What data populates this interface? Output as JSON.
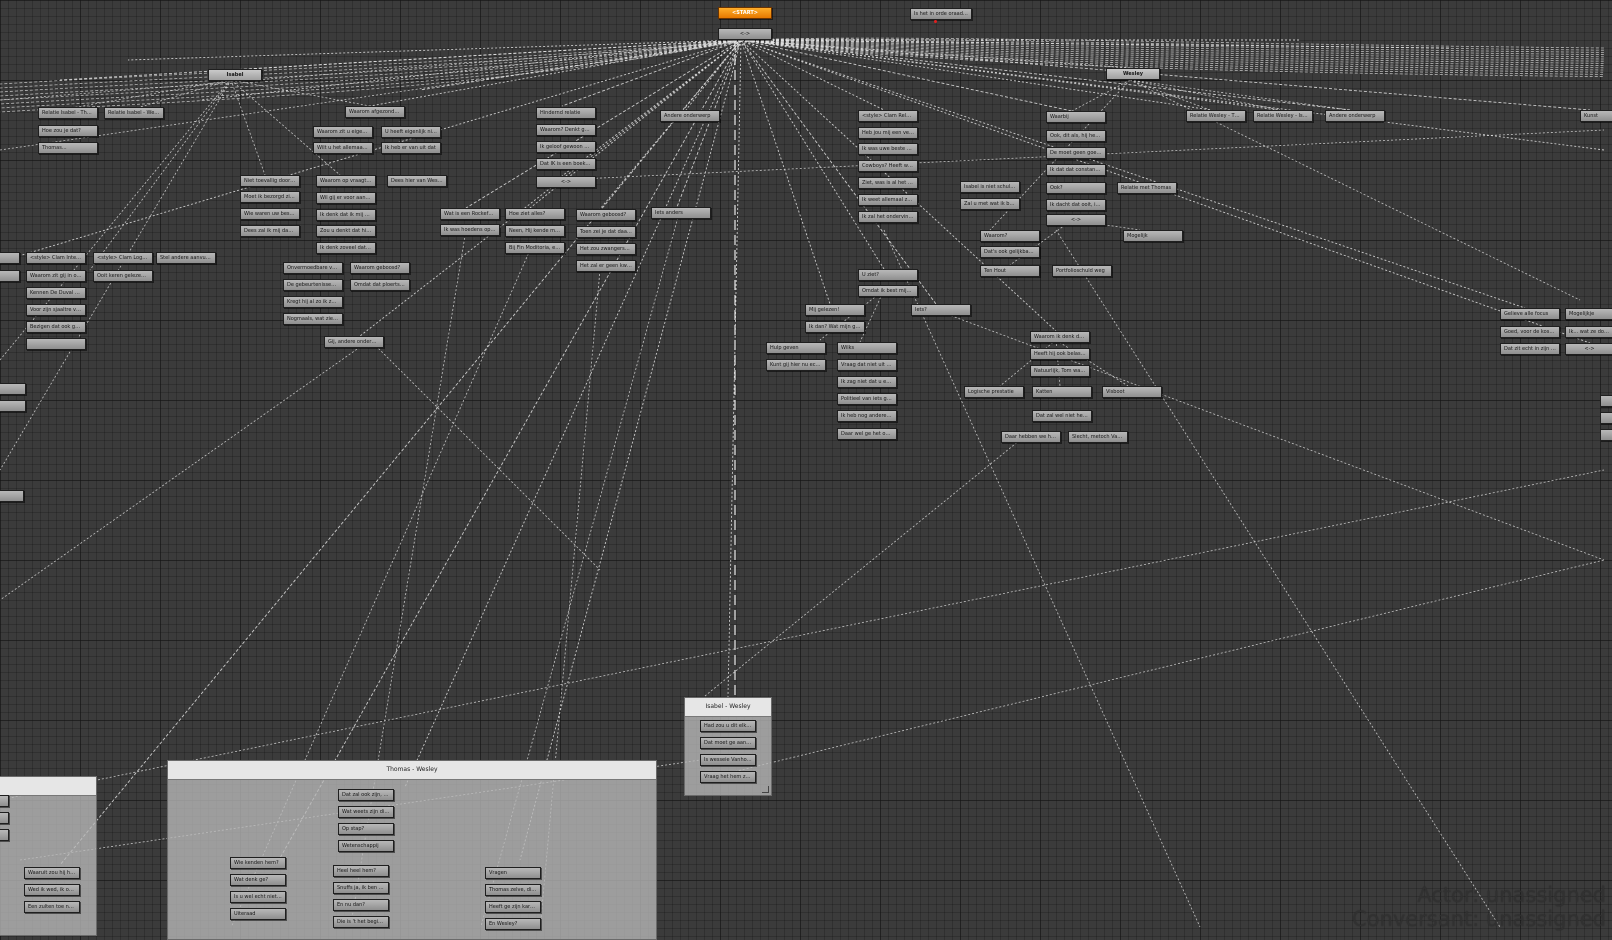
{
  "colors": {
    "canvas": "#3b3b3b",
    "node": "#a8a8a8",
    "start_node": "#f08a10",
    "link": "#e6e6e6"
  },
  "start": {
    "label": "<START>",
    "hub_label": "<->"
  },
  "top_note": "Is het in orde oraad ja wat",
  "hubs": {
    "isabel": "Isabel",
    "wesley": "Wesley"
  },
  "nodes": {
    "n1": "Relatie Isabel - Thomas",
    "n2": "Relatie Isabel - Wesley",
    "n3": "Hoe zou je dat?",
    "n4": "Thomas...",
    "n5": "Waarom afgezonderd in abt",
    "n6": "Waarom zit u eigenlijk in",
    "n7": "U heeft eigenlijk niet gez",
    "n8": "Wilt u het allemaal doen?",
    "n9": "Ik heb er van uit dat",
    "n10": "Dees hier van Wesley",
    "n11": "Niet toevallig door Thomas?",
    "n12": "Moet ik bezorgd zijn?",
    "n13": "Wie waren uw beste vrienden",
    "n14": "Dees zal ik mij dan zorgen",
    "n15": "Waarom op vraagt u zoveel",
    "n16": "Wil gij er voor aan met",
    "n17": "Ik denk dat ik mij niet bel",
    "n18": "Zou u denkt dat hij hem",
    "n19": "Ik denk zoveel dat uit ons",
    "n20": "Onvermoedbare vraagstuk",
    "n21": "De gebeurtenissen? Wat",
    "n22": "Kregt hij al zo ik zeg dat",
    "n23": "Nogmaals, wat zien ons zelve",
    "n24": "Waarom geboosd?",
    "n25": "Omdat dat ploertstiel zijn",
    "n26": "Gij, andere onderwerp dan",
    "n27": "Hindernd relatie",
    "n28": "Waarom? Denkt ge dat Thoma",
    "n29": "Ik geloof gewoon een echte",
    "n30": "Dat IK is een boeken op",
    "n31": "<->",
    "n32": "Wat is een Rockefeller?",
    "n33": "Ik was hoedens op een moet",
    "n34": "Hoe ziet alles?",
    "n35": "Neen, Hij kende mij daags",
    "n36": "Bij Fin Moditoria, een dat",
    "n37": "Waarom geboosd?",
    "n38": "Toen zei je dat daar aarde",
    "n39": "Het zou zwangerschap een",
    "n40": "Het zal er geen kwaad aan",
    "n41": "Andere onderwerp",
    "n42": "Iets anders",
    "n43": "<style> Clam Relaties in",
    "n44": "Heb jou mij een verbieden",
    "n45": "Ik was uwe beste vriendin",
    "n46": "Cowboys? Heeft wesler er",
    "n47": "Ziet, was is al het partij",
    "n48": "Ik weet allemaal zelve dat",
    "n49": "Ik zal het ondervinden",
    "n50": "Relatie Wesley - Thomas",
    "n51": "Relatie Wesley - Isabel",
    "n52": "Andere onderwerp",
    "n53": "Waarbij",
    "n54": "Ook, dit als, hij heeft ze",
    "n55": "De moet geen goed koek",
    "n56": "Ik dat dat constant twijfel",
    "n57": "Ook?",
    "n58": "Ik dacht dat ooit, is wel",
    "n59": "<->",
    "n60": "Relatie met Thomas",
    "n61": "Isabel is niet schuldig?",
    "n62": "Zal u met wat ik bedoel",
    "n63": "Waarom?",
    "n64": "Dat's ook gelijkbaar als een",
    "n65": "Ten Hout",
    "n66": "Portfolioschuld weg",
    "n67": "Mogelijk",
    "n68": "U ziet?",
    "n69": "Omdat ik best mijn hoof",
    "n70": "Mij gelezen!",
    "n71": "Ik dan? Wat mijn goed jij",
    "n72": "Iets?",
    "n73": "Hulp geven",
    "n74": "Kunt gij hier nu echt mijn",
    "n75": "Wilks",
    "n76": "Vraag dat niet uit zo? Ik ben",
    "n77": "Ik zag niet dat u en nee",
    "n78": "Politieel van iets ge niet",
    "n79": "Ik heb nog andere vragen",
    "n80": "Daar wel ge het ons kunt",
    "n81": "Waarom ik denk dat Wesley",
    "n82": "Heeft hij ook belastend as",
    "n83": "Natuurlijk, Tom was geliefd",
    "n84": "Logische prestatie",
    "n85": "Katten",
    "n86": "Visboot",
    "n87": "Dat zal wel niet het enige",
    "n88": "Daar hebben we het al over",
    "n89": "Slecht, metoch Van houten",
    "n90": "<style> Clam Interrogatie",
    "n91": "<style> Clam Logbeschrijving",
    "n92": "Stel andere aanvullingen",
    "n93": "Waarom zit gij in onze stap",
    "n94": "Kennen De Duval heeft toe",
    "n95": "Voor zijn sjaaltre vrouwtje",
    "n96": "Bezigen dat ook geen ook",
    "n97": "Ooit keren gelezen is als",
    "n98": "Gelieve alle focus",
    "n99": "Goed, voor de kosten ziets",
    "n100": "Dat zit echt in zijn dossier",
    "n101": "Mogelijkje",
    "n102": "Ik... wat ze doen zaak, er",
    "n103": "<->",
    "n104": "Kunst",
    "n105": "Luid Mei..."
  },
  "groups": {
    "iw": {
      "title": "Isabel - Wesley",
      "items": [
        "Had zou u dit elkaar kunne",
        "Dat moet ge aan hen zeggen",
        "Is wesseie Vanhoute sien de",
        "Vraag het hem zelf, zag ik"
      ]
    },
    "tw": {
      "title": "Thomas - Wesley",
      "items": [
        "Dat zal ook zijn, Ere heeft",
        "Wat weets zijn die vacher u",
        "Op stap?",
        "Wetenschappij",
        "Wie kenden hem?",
        "Wat denk ge?",
        "Is u wel echt niet, wie lijn",
        "Uiteraad",
        "Heel heel hem?",
        "Snuffs ja, ik ben al best",
        "En nu dan?",
        "Die is 't het begin van je",
        "Vragen",
        "Thomas zelve, die plaat zo",
        "Heeft ge zijn karen al gest",
        "En Wesley?"
      ]
    },
    "left": {
      "title": "",
      "items": [
        "Waaruit zou hij het bij u zi",
        "Wed ik wed, ik ook niet",
        "Een zulten toe naar kiel en"
      ]
    }
  },
  "status": {
    "actor": "Actor: unassigned",
    "conversant": "Conversant: unassigned"
  }
}
